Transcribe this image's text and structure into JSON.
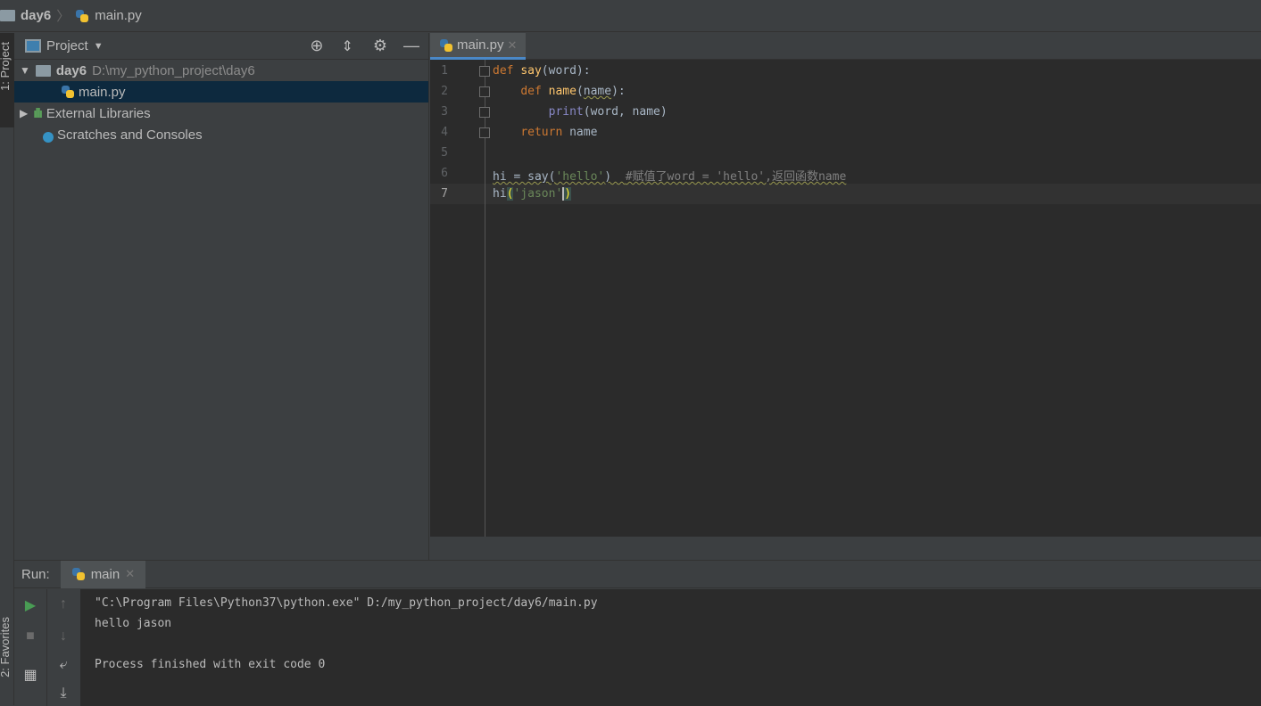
{
  "breadcrumb": {
    "project": "day6",
    "file": "main.py"
  },
  "left_strip": {
    "project_tab": "1: Project",
    "favorites_tab": "2: Favorites"
  },
  "project_panel": {
    "title": "Project",
    "tree": [
      {
        "label": "day6",
        "path": "D:\\my_python_project\\day6",
        "icon": "folder-icon",
        "expanded": true
      },
      {
        "label": "main.py",
        "icon": "python-file-icon",
        "selected": true
      },
      {
        "label": "External Libraries",
        "icon": "libraries-icon"
      },
      {
        "label": "Scratches and Consoles",
        "icon": "scratches-icon"
      }
    ]
  },
  "editor": {
    "tab": "main.py",
    "current_line": 7,
    "line_numbers": [
      "1",
      "2",
      "3",
      "4",
      "5",
      "6",
      "7"
    ]
  },
  "run": {
    "label": "Run:",
    "tab": "main",
    "output": [
      "\"C:\\Program Files\\Python37\\python.exe\" D:/my_python_project/day6/main.py",
      "hello jason",
      "",
      "Process finished with exit code 0"
    ]
  },
  "colors": {
    "keyword": "#cc7832",
    "function": "#ffc66d",
    "string": "#6a8759",
    "builtin": "#8888c6",
    "comment": "#808080",
    "run_green": "#499c54",
    "selection": "#0d293e",
    "tab_accent": "#4a88c7"
  }
}
